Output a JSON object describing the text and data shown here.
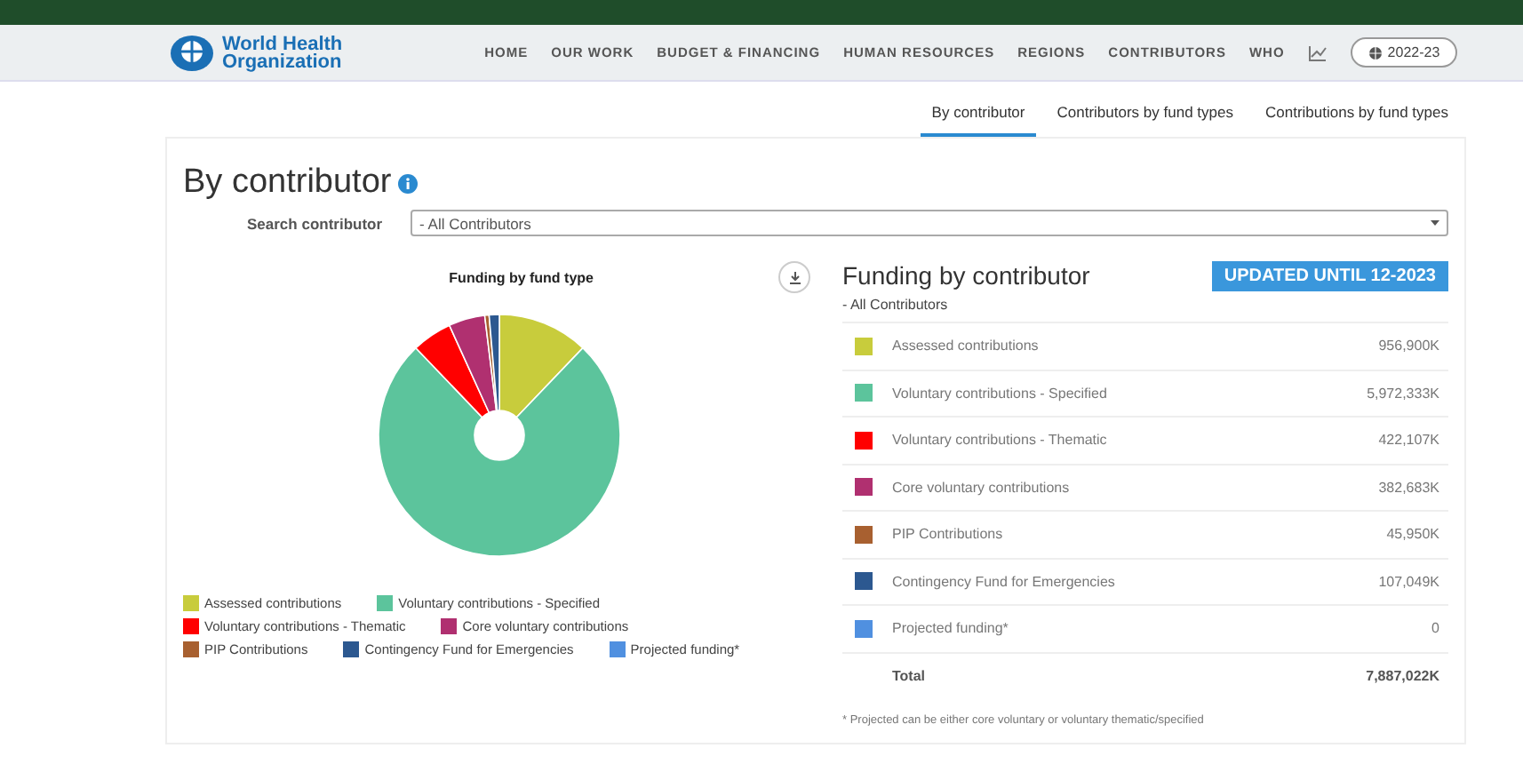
{
  "header": {
    "logo_text": [
      "World Health",
      "Organization"
    ],
    "nav": [
      "HOME",
      "OUR WORK",
      "BUDGET & FINANCING",
      "HUMAN RESOURCES",
      "REGIONS",
      "CONTRIBUTORS",
      "WHO"
    ],
    "period": "2022-23"
  },
  "tabs": [
    {
      "label": "By contributor",
      "selected": true
    },
    {
      "label": "Contributors by fund types",
      "selected": false
    },
    {
      "label": "Contributions by fund types",
      "selected": false
    }
  ],
  "page_title": "By contributor",
  "search": {
    "label": "Search contributor",
    "value": "- All Contributors"
  },
  "chart_panel": {
    "chart_data": {
      "type": "donut",
      "title": "Funding by fund type",
      "categories": [
        "Assessed contributions",
        "Voluntary contributions - Specified",
        "Voluntary contributions - Thematic",
        "Core voluntary contributions",
        "PIP Contributions",
        "Contingency Fund for Emergencies",
        "Projected funding*"
      ],
      "legend": true,
      "series": [
        {
          "colors": [
            "#c8cc3c",
            "#5cc49c",
            "#ff0000",
            "#b03070",
            "#a86030",
            "#2c5890",
            "#5090e0"
          ],
          "values": [
            12.133,
            75.723,
            5.352,
            4.852,
            0.583,
            1.357,
            0
          ]
        }
      ]
    }
  },
  "table_panel": {
    "title": "Funding by contributor",
    "badge": "UPDATED UNTIL 12-2023",
    "subtitle": "- All Contributors",
    "rows": [
      {
        "name": "Assessed contributions",
        "value": "956,900K",
        "color": "#c8cc3c"
      },
      {
        "name": "Voluntary contributions - Specified",
        "value": "5,972,333K",
        "color": "#5cc49c"
      },
      {
        "name": "Voluntary contributions - Thematic",
        "value": "422,107K",
        "color": "#ff0000"
      },
      {
        "name": "Core voluntary contributions",
        "value": "382,683K",
        "color": "#b03070"
      },
      {
        "name": "PIP Contributions",
        "value": "45,950K",
        "color": "#a86030"
      },
      {
        "name": "Contingency Fund for Emergencies",
        "value": "107,049K",
        "color": "#2c5890"
      },
      {
        "name": "Projected funding*",
        "value": "0",
        "color": "#5090e0"
      }
    ],
    "total": {
      "label": "Total",
      "value": "7,887,022K"
    },
    "footnote": "* Projected can be either core voluntary or voluntary thematic/specified"
  }
}
